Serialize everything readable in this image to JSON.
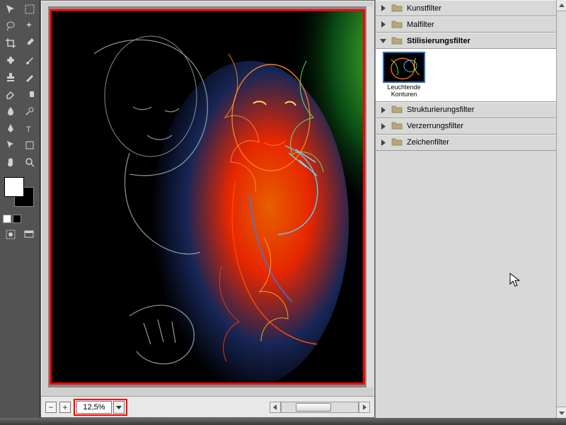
{
  "zoom": {
    "value": "12,5%"
  },
  "filters": {
    "items": [
      {
        "label": "Kunstfilter"
      },
      {
        "label": "Malfilter"
      },
      {
        "label": "Stilisierungsfilter"
      },
      {
        "label": "Strukturierungsfilter"
      },
      {
        "label": "Verzerrungsfilter"
      },
      {
        "label": "Zeichenfilter"
      }
    ],
    "subfilter": {
      "label": "Leuchtende Konturen"
    }
  },
  "colors": {
    "highlight_border": "#f00",
    "selection": "#2a6fb5"
  }
}
